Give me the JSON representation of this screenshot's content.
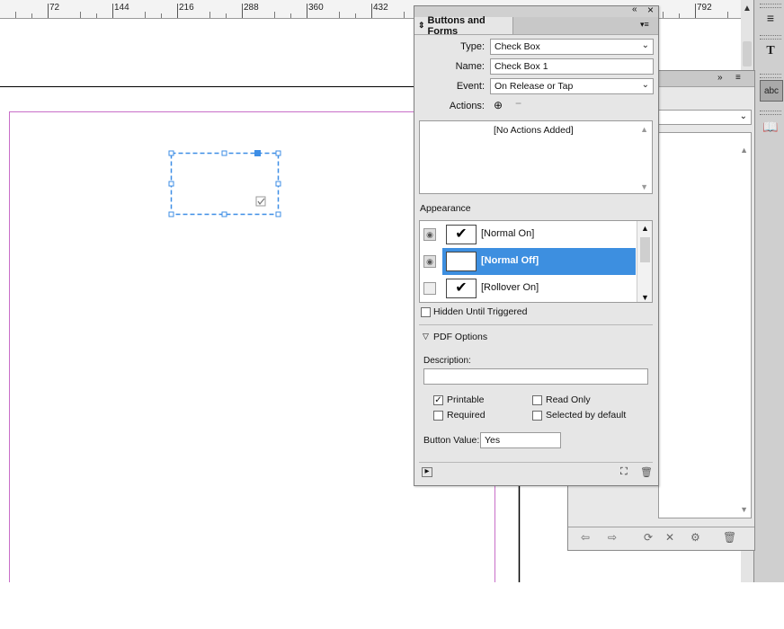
{
  "ruler": {
    "ticks": [
      "72",
      "144",
      "216",
      "288",
      "360",
      "432",
      "792"
    ]
  },
  "panel": {
    "title": "Buttons and Forms",
    "collapse_glyph": "«",
    "close_glyph": "×",
    "menu_glyph": "▾≡",
    "type_label": "Type:",
    "type_value": "Check Box",
    "name_label": "Name:",
    "name_value": "Check Box 1",
    "event_label": "Event:",
    "event_value": "On Release or Tap",
    "actions_label": "Actions:",
    "no_actions_text": "[No Actions Added]",
    "appearance_label": "Appearance",
    "appearance_rows": [
      {
        "label": "[Normal On]",
        "checked": true,
        "selected": false
      },
      {
        "label": "[Normal Off]",
        "checked": false,
        "selected": true
      },
      {
        "label": "[Rollover On]",
        "checked": true,
        "selected": false
      }
    ],
    "hidden_until_triggered": "Hidden Until Triggered",
    "pdf_options": "PDF Options",
    "description_label": "Description:",
    "description_value": "",
    "printable": "Printable",
    "printable_checked": true,
    "read_only": "Read Only",
    "required": "Required",
    "selected_by_default": "Selected by default",
    "button_value_label": "Button Value:",
    "button_value": "Yes"
  },
  "colors": {
    "selection_blue": "#3d8fe0",
    "frame_blue": "#3d8ee6",
    "margin_magenta": "#c86ec8"
  }
}
